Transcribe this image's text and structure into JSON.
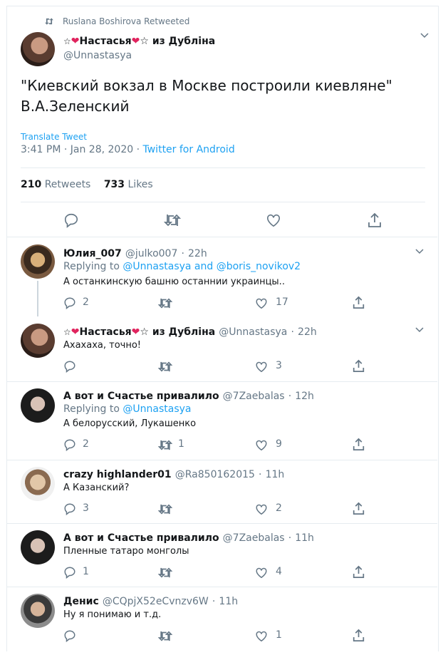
{
  "retweet_context": {
    "text": "Ruslana Boshirova Retweeted",
    "icon": "retweet-icon"
  },
  "main_tweet": {
    "name_prefix": "☆",
    "name_heart": "❤",
    "name_core": "Настасья",
    "name_suffix": "☆ из Дубліна",
    "handle": "@Unnastasya",
    "text_line1": "\"Киевский вокзал в Москве построили киевляне\"",
    "text_line2": "В.А.Зеленский",
    "translate": "Translate Tweet",
    "time": "3:41 PM · Jan 28, 2020",
    "sep": "·",
    "source": "Twitter for Android",
    "retweets_count": "210",
    "retweets_label": "Retweets",
    "likes_count": "733",
    "likes_label": "Likes"
  },
  "colors": {
    "accent": "#1da1f2",
    "muted": "#657786",
    "heart": "#e0245e",
    "border": "#e6ecf0"
  },
  "replies": [
    {
      "name": "Юлия_007",
      "handle": "@julko007",
      "time": "22h",
      "replying_label": "Replying to",
      "replying_to": "@Unnastasya and @boris_novikov2",
      "text": "А останкинскую башню останнии украинцы..",
      "reply_count": "2",
      "retweet_count": "",
      "like_count": "17"
    },
    {
      "name_prefix": "☆",
      "name_core": "Настасья",
      "name_suffix": "☆ из Дубліна",
      "handle": "@Unnastasya",
      "time": "22h",
      "text": "Ахахаха, точно!",
      "reply_count": "",
      "retweet_count": "",
      "like_count": "3"
    },
    {
      "name": "А вот и Счастье привалило",
      "handle": "@7Zaebalas",
      "time": "12h",
      "replying_label": "Replying to",
      "replying_to": "@Unnastasya",
      "text": "А белорусский, Лукашенко",
      "reply_count": "2",
      "retweet_count": "1",
      "like_count": "9"
    },
    {
      "name": "crazy highlander01",
      "handle": "@Ra850162015",
      "time": "11h",
      "text": "А Казанский?",
      "reply_count": "3",
      "retweet_count": "",
      "like_count": "2"
    },
    {
      "name": "А вот и Счастье привалило",
      "handle": "@7Zaebalas",
      "time": "11h",
      "text": "Пленные татаро монголы",
      "reply_count": "1",
      "retweet_count": "",
      "like_count": "4"
    },
    {
      "name": "Денис",
      "handle": "@CQpjX52eCvnzv6W",
      "time": "11h",
      "text": "Ну я понимаю и т.д.",
      "reply_count": "",
      "retweet_count": "",
      "like_count": "1"
    }
  ]
}
